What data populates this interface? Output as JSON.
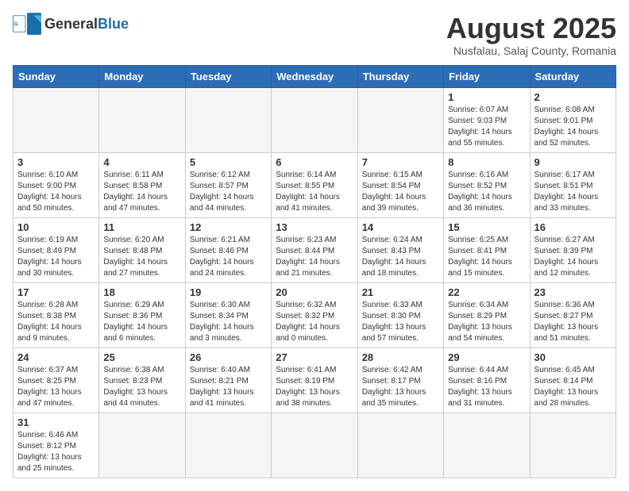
{
  "logo": {
    "text_general": "General",
    "text_blue": "Blue"
  },
  "title": "August 2025",
  "subtitle": "Nusfalau, Salaj County, Romania",
  "weekdays": [
    "Sunday",
    "Monday",
    "Tuesday",
    "Wednesday",
    "Thursday",
    "Friday",
    "Saturday"
  ],
  "weeks": [
    [
      {
        "day": "",
        "info": ""
      },
      {
        "day": "",
        "info": ""
      },
      {
        "day": "",
        "info": ""
      },
      {
        "day": "",
        "info": ""
      },
      {
        "day": "",
        "info": ""
      },
      {
        "day": "1",
        "info": "Sunrise: 6:07 AM\nSunset: 9:03 PM\nDaylight: 14 hours and 55 minutes."
      },
      {
        "day": "2",
        "info": "Sunrise: 6:08 AM\nSunset: 9:01 PM\nDaylight: 14 hours and 52 minutes."
      }
    ],
    [
      {
        "day": "3",
        "info": "Sunrise: 6:10 AM\nSunset: 9:00 PM\nDaylight: 14 hours and 50 minutes."
      },
      {
        "day": "4",
        "info": "Sunrise: 6:11 AM\nSunset: 8:58 PM\nDaylight: 14 hours and 47 minutes."
      },
      {
        "day": "5",
        "info": "Sunrise: 6:12 AM\nSunset: 8:57 PM\nDaylight: 14 hours and 44 minutes."
      },
      {
        "day": "6",
        "info": "Sunrise: 6:14 AM\nSunset: 8:55 PM\nDaylight: 14 hours and 41 minutes."
      },
      {
        "day": "7",
        "info": "Sunrise: 6:15 AM\nSunset: 8:54 PM\nDaylight: 14 hours and 39 minutes."
      },
      {
        "day": "8",
        "info": "Sunrise: 6:16 AM\nSunset: 8:52 PM\nDaylight: 14 hours and 36 minutes."
      },
      {
        "day": "9",
        "info": "Sunrise: 6:17 AM\nSunset: 8:51 PM\nDaylight: 14 hours and 33 minutes."
      }
    ],
    [
      {
        "day": "10",
        "info": "Sunrise: 6:19 AM\nSunset: 8:49 PM\nDaylight: 14 hours and 30 minutes."
      },
      {
        "day": "11",
        "info": "Sunrise: 6:20 AM\nSunset: 8:48 PM\nDaylight: 14 hours and 27 minutes."
      },
      {
        "day": "12",
        "info": "Sunrise: 6:21 AM\nSunset: 8:46 PM\nDaylight: 14 hours and 24 minutes."
      },
      {
        "day": "13",
        "info": "Sunrise: 6:23 AM\nSunset: 8:44 PM\nDaylight: 14 hours and 21 minutes."
      },
      {
        "day": "14",
        "info": "Sunrise: 6:24 AM\nSunset: 8:43 PM\nDaylight: 14 hours and 18 minutes."
      },
      {
        "day": "15",
        "info": "Sunrise: 6:25 AM\nSunset: 8:41 PM\nDaylight: 14 hours and 15 minutes."
      },
      {
        "day": "16",
        "info": "Sunrise: 6:27 AM\nSunset: 8:39 PM\nDaylight: 14 hours and 12 minutes."
      }
    ],
    [
      {
        "day": "17",
        "info": "Sunrise: 6:28 AM\nSunset: 8:38 PM\nDaylight: 14 hours and 9 minutes."
      },
      {
        "day": "18",
        "info": "Sunrise: 6:29 AM\nSunset: 8:36 PM\nDaylight: 14 hours and 6 minutes."
      },
      {
        "day": "19",
        "info": "Sunrise: 6:30 AM\nSunset: 8:34 PM\nDaylight: 14 hours and 3 minutes."
      },
      {
        "day": "20",
        "info": "Sunrise: 6:32 AM\nSunset: 8:32 PM\nDaylight: 14 hours and 0 minutes."
      },
      {
        "day": "21",
        "info": "Sunrise: 6:33 AM\nSunset: 8:30 PM\nDaylight: 13 hours and 57 minutes."
      },
      {
        "day": "22",
        "info": "Sunrise: 6:34 AM\nSunset: 8:29 PM\nDaylight: 13 hours and 54 minutes."
      },
      {
        "day": "23",
        "info": "Sunrise: 6:36 AM\nSunset: 8:27 PM\nDaylight: 13 hours and 51 minutes."
      }
    ],
    [
      {
        "day": "24",
        "info": "Sunrise: 6:37 AM\nSunset: 8:25 PM\nDaylight: 13 hours and 47 minutes."
      },
      {
        "day": "25",
        "info": "Sunrise: 6:38 AM\nSunset: 8:23 PM\nDaylight: 13 hours and 44 minutes."
      },
      {
        "day": "26",
        "info": "Sunrise: 6:40 AM\nSunset: 8:21 PM\nDaylight: 13 hours and 41 minutes."
      },
      {
        "day": "27",
        "info": "Sunrise: 6:41 AM\nSunset: 8:19 PM\nDaylight: 13 hours and 38 minutes."
      },
      {
        "day": "28",
        "info": "Sunrise: 6:42 AM\nSunset: 8:17 PM\nDaylight: 13 hours and 35 minutes."
      },
      {
        "day": "29",
        "info": "Sunrise: 6:44 AM\nSunset: 8:16 PM\nDaylight: 13 hours and 31 minutes."
      },
      {
        "day": "30",
        "info": "Sunrise: 6:45 AM\nSunset: 8:14 PM\nDaylight: 13 hours and 28 minutes."
      }
    ],
    [
      {
        "day": "31",
        "info": "Sunrise: 6:46 AM\nSunset: 8:12 PM\nDaylight: 13 hours and 25 minutes."
      },
      {
        "day": "",
        "info": ""
      },
      {
        "day": "",
        "info": ""
      },
      {
        "day": "",
        "info": ""
      },
      {
        "day": "",
        "info": ""
      },
      {
        "day": "",
        "info": ""
      },
      {
        "day": "",
        "info": ""
      }
    ]
  ]
}
